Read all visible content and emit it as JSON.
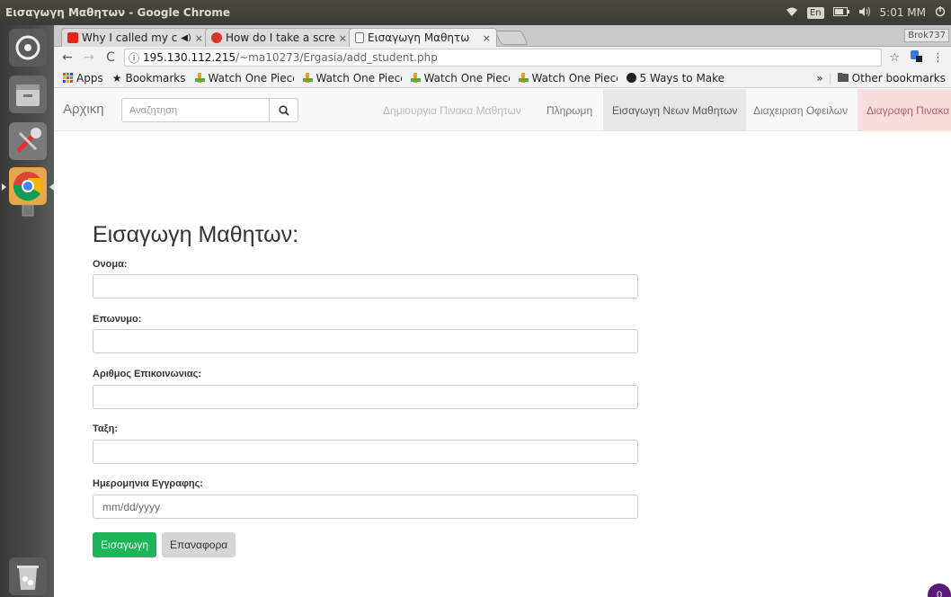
{
  "os": {
    "window_title": "Εισαγωγη Μαθητων - Google Chrome",
    "language": "En",
    "clock": "5:01 ΜΜ"
  },
  "browser": {
    "tabs": [
      {
        "label": "Why I called my c",
        "favicon": "youtube-icon",
        "close": "×",
        "extra": "◀)"
      },
      {
        "label": "How do I take a scre",
        "favicon": "ask-icon",
        "close": "×"
      },
      {
        "label": "Εισαγωγη Μαθητω",
        "favicon": "document-icon",
        "close": "×",
        "active": true
      }
    ],
    "profile": "Brok737",
    "url_prefix": "ⓘ",
    "url_host": "195.130.112.215",
    "url_path": "/~ma10273/Ergasia/add_student.php",
    "bookmarks": [
      {
        "label": "Apps",
        "icon": "apps-grid-icon"
      },
      {
        "label": "Bookmarks",
        "icon": "star-icon"
      },
      {
        "label": "Watch One Piece",
        "icon": "onepiece-icon"
      },
      {
        "label": "Watch One Piece",
        "icon": "onepiece-icon"
      },
      {
        "label": "Watch One Piece",
        "icon": "onepiece-icon"
      },
      {
        "label": "Watch One Piece",
        "icon": "onepiece-icon"
      },
      {
        "label": "5 Ways to Make",
        "icon": "wikihow-icon"
      }
    ],
    "bookmarks_overflow": "»",
    "other_bookmarks": "Other bookmarks"
  },
  "navbar": {
    "brand": "Αρχικη",
    "search_placeholder": "Αναζητηση",
    "links": [
      {
        "label": "Δημιουργια Πινακα Μαθητων",
        "state": "dim"
      },
      {
        "label": "Πληρωμη",
        "state": "normal"
      },
      {
        "label": "Εισαγωγη Νεων Μαθητων",
        "state": "active"
      },
      {
        "label": "Διαχειριση Οφειλων",
        "state": "normal"
      },
      {
        "label": "Διαγραφη Πινακα",
        "state": "danger"
      }
    ]
  },
  "form": {
    "title": "Εισαγωγη Μαθητων:",
    "fields": [
      {
        "label": "Ονομα:",
        "value": "",
        "placeholder": ""
      },
      {
        "label": "Επωνυμο:",
        "value": "",
        "placeholder": ""
      },
      {
        "label": "Αριθμος Επικοινωνιας:",
        "value": "",
        "placeholder": ""
      },
      {
        "label": "Ταξη:",
        "value": "",
        "placeholder": ""
      },
      {
        "label": "Ημερομηνια Εγγραφης:",
        "value": "",
        "placeholder": "mm/dd/yyyy"
      }
    ],
    "submit_label": "Εισαγωγη",
    "reset_label": "Επαναφορα"
  },
  "chat_badge": "0",
  "colors": {
    "submit": "#1eb45a",
    "danger_tab": "#f9dcdc",
    "active_tab": "#e7e7e7",
    "badge": "#5b1a7a"
  }
}
